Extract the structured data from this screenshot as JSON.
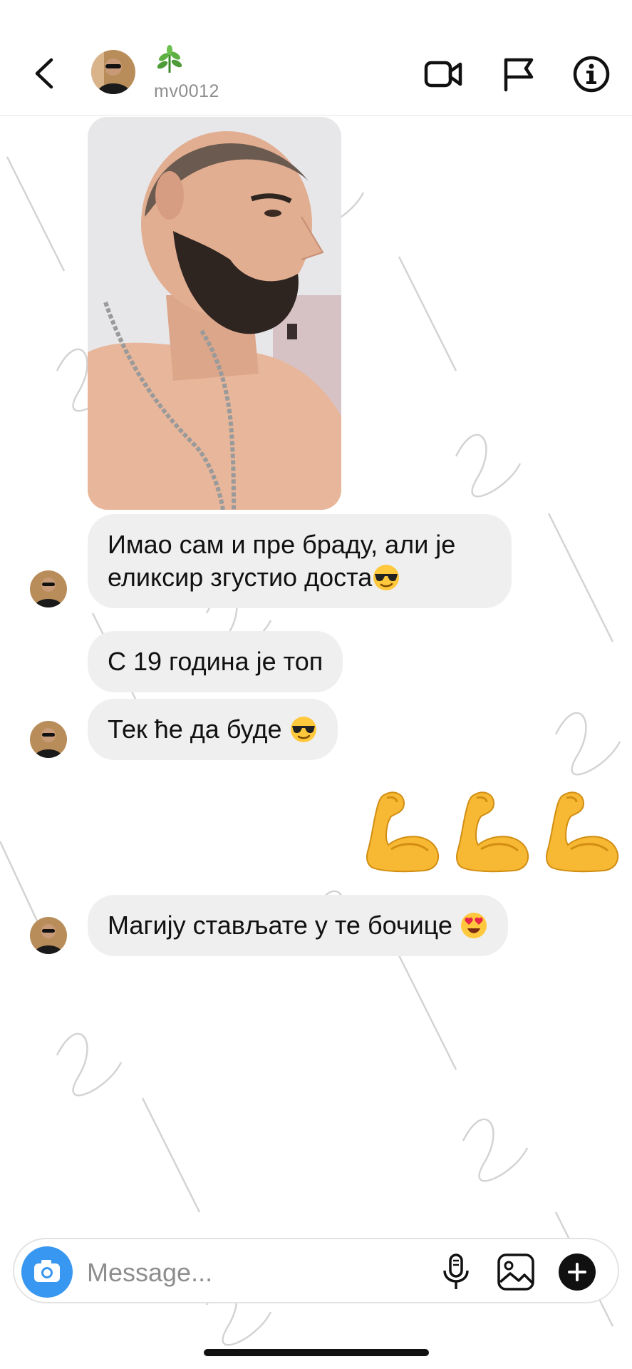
{
  "header": {
    "username": "mv0012",
    "back_icon": "chevron-left-icon",
    "video_icon": "video-camera-icon",
    "flag_icon": "flag-icon",
    "info_icon": "info-icon"
  },
  "messages": [
    {
      "type": "image",
      "description_icon": "photo-message"
    },
    {
      "type": "text",
      "text": "Имао сам и пре браду, али је еликсир згустио доста",
      "emoji": "sunglasses-emoji"
    },
    {
      "type": "text",
      "text": "С 19 година је топ"
    },
    {
      "type": "text",
      "text": "Тек ће да буде",
      "emoji": "sunglasses-emoji"
    },
    {
      "type": "emoji",
      "emoji": "flexed-biceps-emoji",
      "count": 3
    },
    {
      "type": "text",
      "text": "Магију стављате у те бочице",
      "emoji": "heart-eyes-emoji"
    }
  ],
  "composer": {
    "placeholder": "Message...",
    "camera_icon": "camera-icon",
    "mic_icon": "microphone-icon",
    "gallery_icon": "gallery-icon",
    "plus_icon": "plus-icon"
  },
  "colors": {
    "accent": "#3897f0",
    "bubble": "#efefef",
    "secondary_text": "#8e8e8e"
  }
}
